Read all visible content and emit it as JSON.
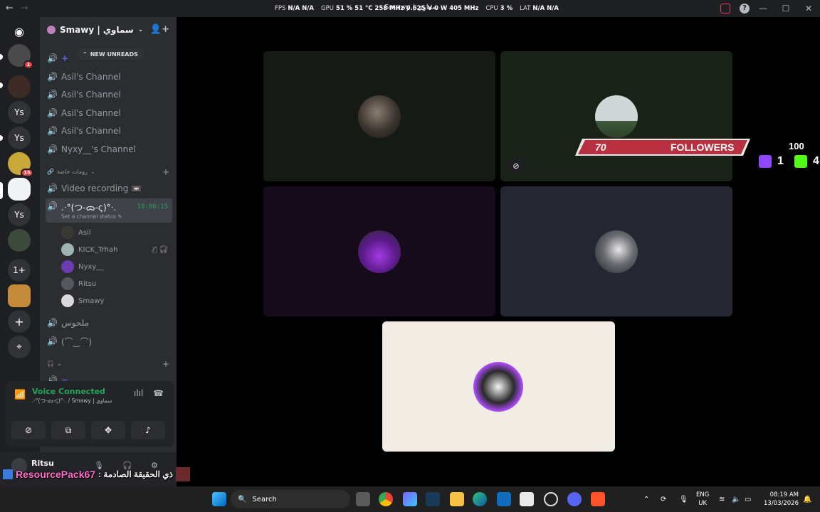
{
  "titlebar": {
    "window_title": "Smawy | سماوي",
    "stats": [
      {
        "key": "FPS",
        "value": "N/A N/A"
      },
      {
        "key": "GPU",
        "value": "51 % 51 °C 258 MHz 0.625 V 0 W 405 MHz"
      },
      {
        "key": "CPU",
        "value": "3 %"
      },
      {
        "key": "LAT",
        "value": "N/A N/A"
      }
    ]
  },
  "rail": {
    "items": [
      {
        "label": "",
        "icon": "discord-logo-icon"
      },
      {
        "label": "",
        "badge": "1"
      },
      {
        "label": ""
      },
      {
        "label": "Ys"
      },
      {
        "label": "Ys"
      },
      {
        "label": "",
        "badge": "15"
      },
      {
        "label": ""
      },
      {
        "label": "Ys"
      },
      {
        "label": ""
      },
      {
        "label": "1+"
      },
      {
        "label": ""
      },
      {
        "label": "+",
        "icon": "add-server-icon"
      },
      {
        "label": "⌖",
        "icon": "discover-icon"
      }
    ]
  },
  "sidebar": {
    "server_name": "Smawy | سماوي",
    "new_unreads": "NEW UNREADS",
    "channels": [
      "Asil's Channel",
      "Asil's Channel",
      "Asil's Channel",
      "Asil's Channel",
      "Nyxy__'s Channel"
    ],
    "category_private": "رومات خاصة",
    "video_recording": "Video recording 📼",
    "active_channel": {
      "name": ".·°(つ-ᯅ-ς)°·.",
      "timer": "10:06:15",
      "status_hint": "Set a channel status"
    },
    "members": [
      {
        "name": "Asil"
      },
      {
        "name": "KICK_Trhah"
      },
      {
        "name": "Nyxy__"
      },
      {
        "name": "Ritsu"
      },
      {
        "name": "Smawy"
      }
    ],
    "channels_after": [
      "ملحوس",
      "(⌒‿⌒)"
    ]
  },
  "voice": {
    "title": "Voice Connected",
    "subtitle": ".·°(つ-ᯅ-ς)°·. / Smawy | سماوي"
  },
  "user": {
    "name": "Ritsu"
  },
  "overlay": {
    "followers_count": "70",
    "followers_label": "FOLLOWERS",
    "goal": "100",
    "twitch_count": "1",
    "kick_count": "4",
    "resource_pack_name": "ResourcePack67",
    "resource_pack_suffix": ": ذي الحقيقة الصادمة"
  },
  "taskbar": {
    "search_placeholder": "Search",
    "lang_top": "ENG",
    "lang_bottom": "UK",
    "time": "08:19 AM",
    "date": "13/03/2026"
  },
  "colors": {
    "accent_green": "#23a55a",
    "followers_red": "#b8303f",
    "twitch_purple": "#9146ff",
    "kick_green": "#53fc18"
  }
}
